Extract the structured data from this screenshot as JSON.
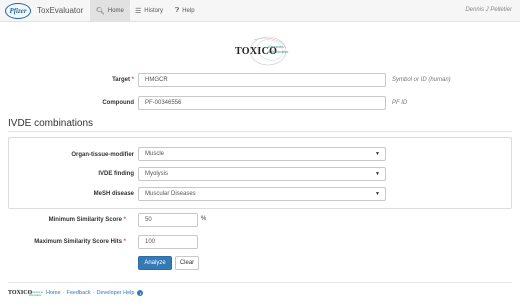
{
  "navbar": {
    "logo_text": "Pfizer",
    "app_name": "ToxEvaluator",
    "tabs": [
      {
        "label": "Home",
        "icon": "search-icon",
        "active": true
      },
      {
        "label": "History",
        "icon": "list-icon",
        "active": false
      },
      {
        "label": "Help",
        "icon": "question-circle-icon",
        "active": false
      }
    ],
    "user": "Dennis J Pelletier"
  },
  "logo": {
    "word": "TOXICO",
    "sub_line1": "Genomics",
    "sub_line2": "& Informatics"
  },
  "form": {
    "target": {
      "label": "Target",
      "required_mark": "*",
      "value": "HMGCR",
      "hint": "Symbol or ID (human)"
    },
    "compound": {
      "label": "Compound",
      "value": "PF-00346556",
      "hint": "PF ID"
    }
  },
  "ivde": {
    "title": "IVDE combinations",
    "organ": {
      "label": "Organ-tissue-modifier",
      "value": "Muscle"
    },
    "finding": {
      "label": "IVDE finding",
      "value": "Myolysis"
    },
    "mesh": {
      "label": "MeSH disease",
      "value": "Muscular Diseases"
    }
  },
  "scores": {
    "min_similarity": {
      "label": "Minimum Similarity Score",
      "required_mark": "*",
      "value": "50",
      "unit": "%"
    },
    "max_hits": {
      "label": "Maximum Similarity Score Hits",
      "required_mark": "*",
      "value": "100"
    }
  },
  "buttons": {
    "analyze": "Analyze",
    "clear": "Clear"
  },
  "footer": {
    "logo_word": "TOXICO",
    "logo_sub": "Genomics & Informatics",
    "links": [
      "Home",
      "Feedback",
      "Developer Help"
    ],
    "separator": "·",
    "info_glyph": "i"
  },
  "colors": {
    "primary": "#337ab7",
    "required": "#d9534f",
    "brand": "#1a67b2"
  }
}
